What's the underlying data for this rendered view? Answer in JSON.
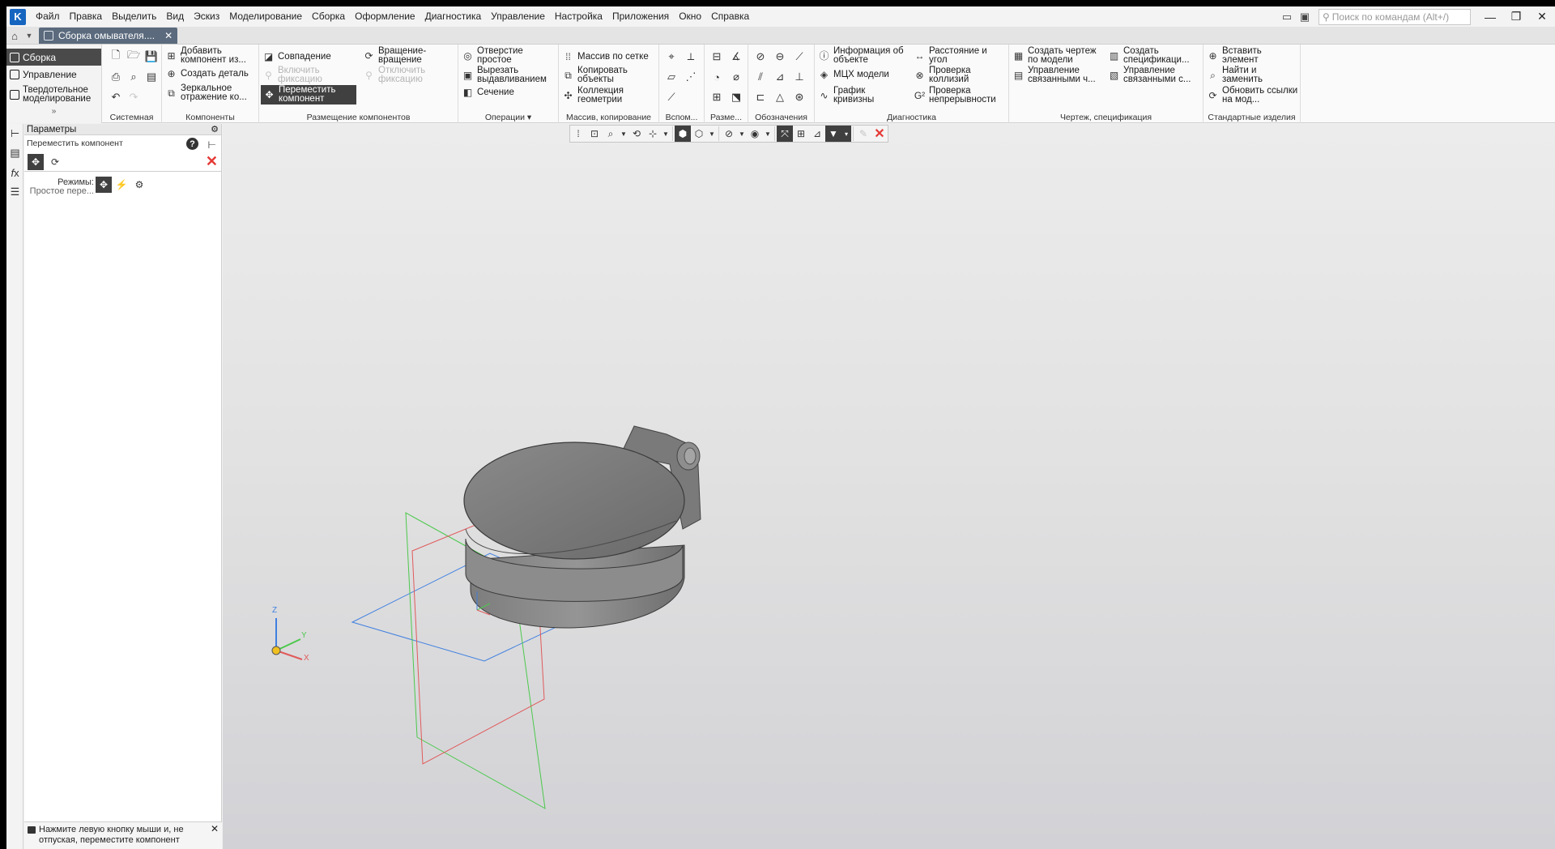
{
  "titlebar": {
    "menu": [
      "Файл",
      "Правка",
      "Выделить",
      "Вид",
      "Эскиз",
      "Моделирование",
      "Сборка",
      "Оформление",
      "Диагностика",
      "Управление",
      "Настройка",
      "Приложения",
      "Окно",
      "Справка"
    ],
    "search_placeholder": "Поиск по командам (Alt+/)"
  },
  "tabs": {
    "document_tab": "Сборка омывателя...."
  },
  "ribbon": {
    "nav": {
      "assembly": "Сборка",
      "management": "Управление",
      "solid": "Твердотельное моделирование"
    },
    "groups": {
      "system": "Системная",
      "components": "Компоненты",
      "placement": "Размещение компонентов",
      "operations": "Операции",
      "array": "Массив, копирование",
      "aux": "Вспом...",
      "dims": "Разме...",
      "notation": "Обозначения",
      "diagnostics": "Диагностика",
      "drawing": "Чертеж, спецификация",
      "standard": "Стандартные изделия"
    },
    "buttons": {
      "add_component": "Добавить компонент из...",
      "create_part": "Создать деталь",
      "mirror": "Зеркальное отражение ко...",
      "coincidence": "Совпадение",
      "enable_fix": "Включить фиксацию",
      "move_component": "Переместить компонент",
      "rotation": "Вращение-вращение",
      "disable_fix": "Отключить фиксацию",
      "hole": "Отверстие простое",
      "cut_extrude": "Вырезать выдавливанием",
      "section": "Сечение",
      "grid_array": "Массив по сетке",
      "copy_objects": "Копировать объекты",
      "geom_collection": "Коллекция геометрии",
      "object_info": "Информация об объекте",
      "mcs": "МЦХ модели",
      "curvature": "График кривизны",
      "distance_angle": "Расстояние и угол",
      "collisions": "Проверка коллизий",
      "continuity": "Проверка непрерывности",
      "create_drawing": "Создать чертеж по модели",
      "manage_linked_drawings": "Управление связанными ч...",
      "create_spec": "Создать спецификаци...",
      "manage_linked_spec": "Управление связанными с...",
      "insert_element": "Вставить элемент",
      "find_replace": "Найти и заменить",
      "update_links": "Обновить ссылки на мод..."
    }
  },
  "panel": {
    "title": "Параметры",
    "command": "Переместить компонент",
    "modes_label": "Режимы:",
    "modes_value": "Простое пере...",
    "hint": "Нажмите левую кнопку мыши и, не отпуская, переместите компонент"
  },
  "viewport": {
    "axis_x": "X",
    "axis_y": "Y",
    "axis_z": "Z"
  },
  "colors": {
    "active_tab": "#5b6a7d",
    "active_button": "#404040",
    "close_red": "#e53935",
    "plane_red": "#e05a5a",
    "plane_green": "#4cc84c",
    "plane_blue": "#3f7fe0"
  }
}
